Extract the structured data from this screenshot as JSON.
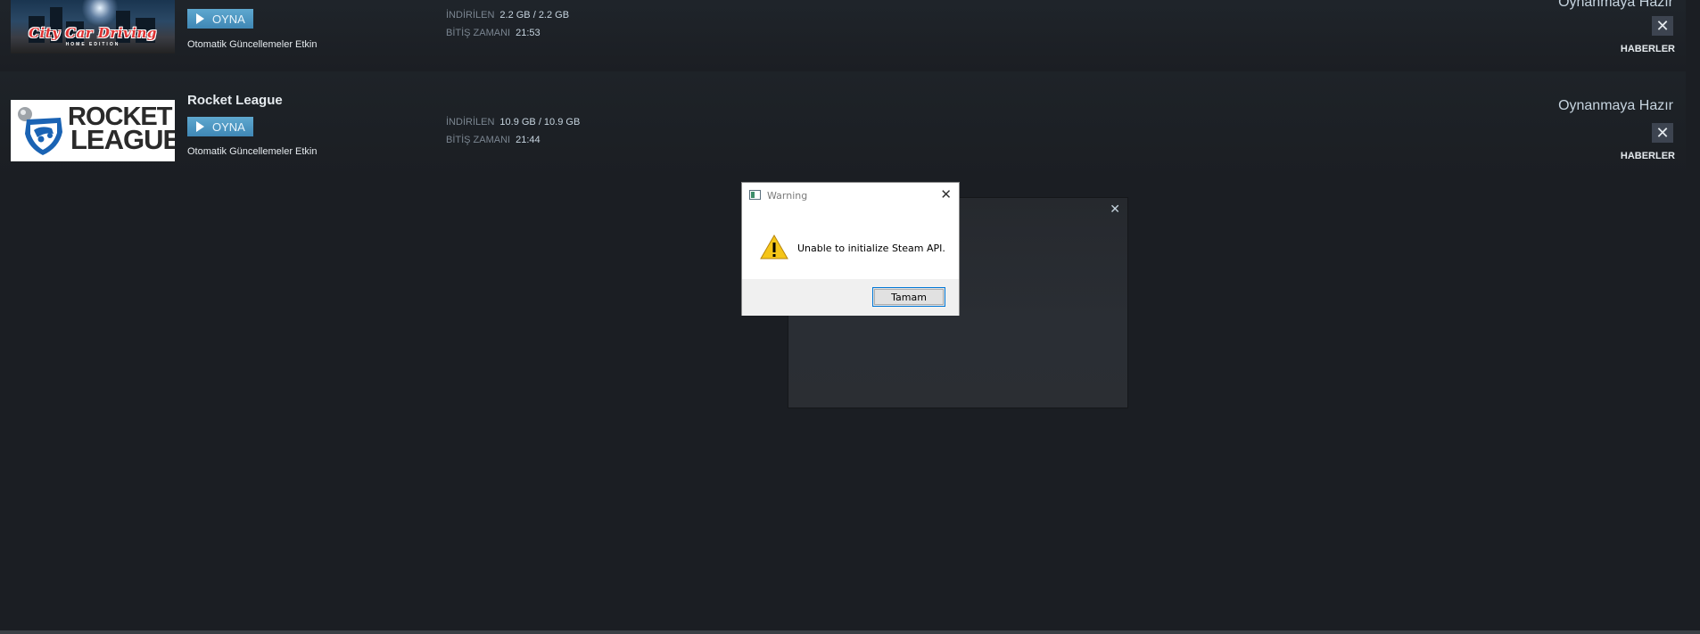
{
  "games": [
    {
      "id": "city-car-driving",
      "thumbnail_text": "City Car Driving",
      "thumbnail_subtext": "HOME EDITION",
      "play_label": "OYNA",
      "auto_updates": "Otomatik Güncellemeler Etkin",
      "downloaded_label": "İNDİRİLEN",
      "downloaded_value": "2.2 GB / 2.2 GB",
      "finish_label": "BİTİŞ ZAMANI",
      "finish_value": "21:53",
      "status": "Oynanmaya Hazır",
      "close_label": "✕",
      "news_label": "HABERLER"
    },
    {
      "id": "rocket-league",
      "title": "Rocket League",
      "thumbnail_line1": "ROCKET",
      "thumbnail_line2": "LEAGUE",
      "play_label": "OYNA",
      "auto_updates": "Otomatik Güncellemeler Etkin",
      "downloaded_label": "İNDİRİLEN",
      "downloaded_value": "10.9 GB / 10.9 GB",
      "finish_label": "BİTİŞ ZAMANI",
      "finish_value": "21:44",
      "status": "Oynanmaya Hazır",
      "close_label": "✕",
      "news_label": "HABERLER"
    }
  ],
  "dark_window": {
    "close_label": "✕"
  },
  "dialog": {
    "title": "Warning",
    "message": "Unable to initialize Steam API.",
    "ok_label": "Tamam",
    "close_label": "✕"
  },
  "colors": {
    "background": "#1b1e23",
    "play_button": "#4c97c4",
    "close_button": "#3d4450",
    "dialog_footer": "#f0f0f0",
    "ok_border": "#0078d7",
    "warning_icon": "#f5c518"
  },
  "icons": [
    "play-icon",
    "close-icon",
    "warning-icon",
    "app-icon"
  ]
}
